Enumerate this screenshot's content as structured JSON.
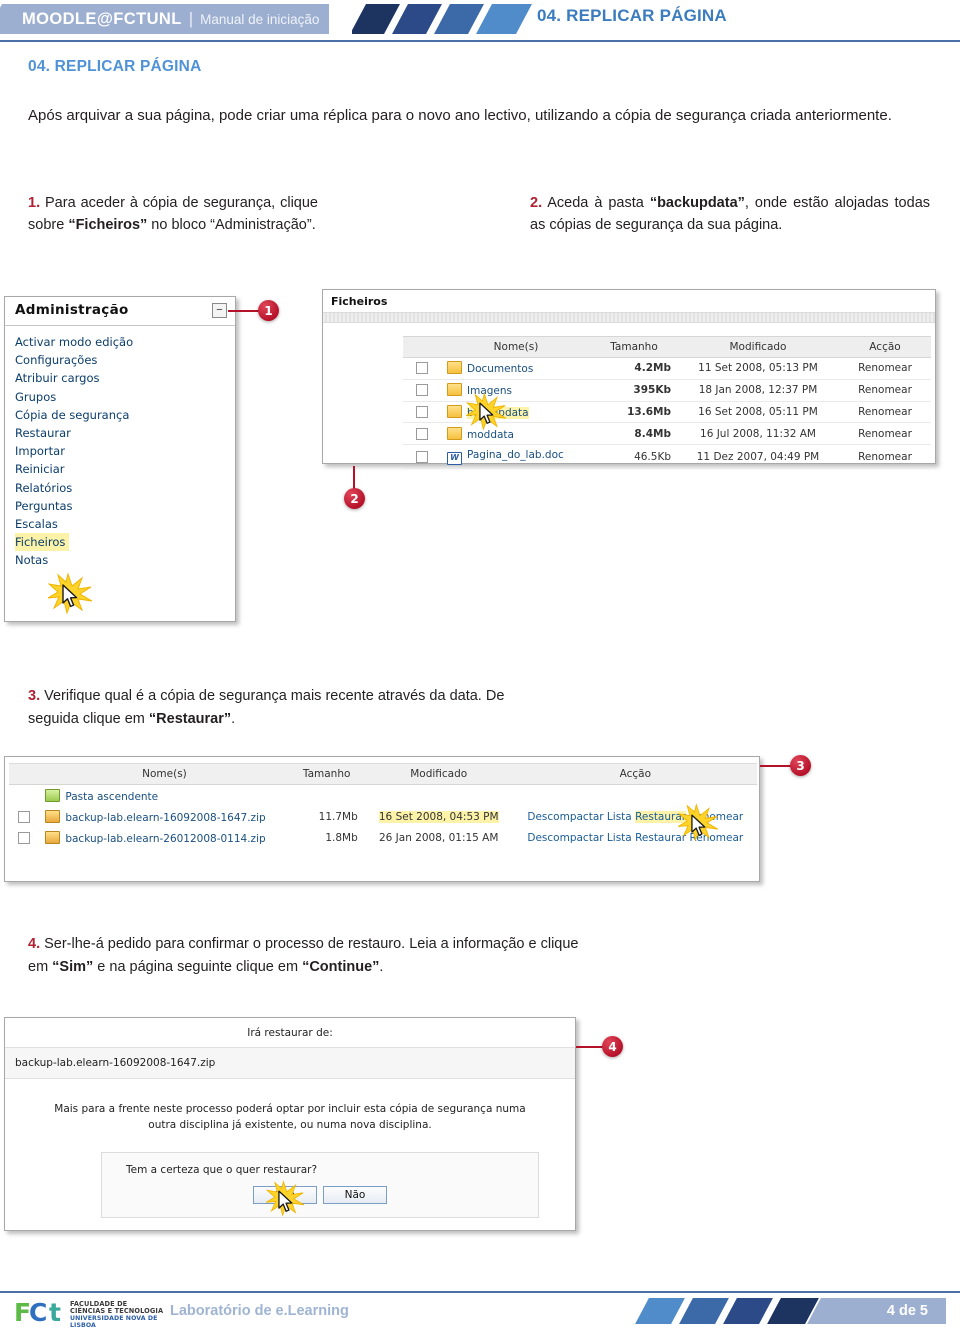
{
  "header": {
    "brand": "MOODLE@FCTUNL",
    "divider": "|",
    "subtitle": "Manual de iniciação",
    "title": "04. REPLICAR PÁGINA"
  },
  "page": {
    "section_title": "04. REPLICAR PÁGINA",
    "intro": "Após arquivar a sua página, pode criar uma réplica para o novo ano lectivo, utilizando a cópia de segurança criada anteriormente."
  },
  "steps": {
    "one": {
      "num": "1.",
      "t1": " Para aceder à cópia de segurança, clique sobre  ",
      "b1": "“Ficheiros”",
      "t2": " no bloco “Administração”."
    },
    "two": {
      "num": "2.",
      "t1": " Aceda à pasta ",
      "b1": "“backupdata”",
      "t2": ", onde estão alojadas todas as cópias de segurança da sua página."
    },
    "three": {
      "num": "3.",
      "t1": " Verifique qual é a cópia de segurança mais recente através da data. De seguida clique em ",
      "b1": "“Restaurar”",
      "t2": "."
    },
    "four": {
      "num": "4.",
      "t1": " Ser-lhe-á pedido para confirmar o processo de restauro. Leia a informação e clique em ",
      "b1": "“Sim”",
      "t2": " e na página seguinte clique em ",
      "b2": "“Continue”",
      "t3": "."
    }
  },
  "admin_block": {
    "title": "Administração",
    "collapse_glyph": "−",
    "items": [
      {
        "label": "Activar modo edição",
        "highlighted": false
      },
      {
        "label": "Configurações",
        "highlighted": false
      },
      {
        "label": "Atribuir cargos",
        "highlighted": false
      },
      {
        "label": "Grupos",
        "highlighted": false
      },
      {
        "label": "Cópia de segurança",
        "highlighted": false
      },
      {
        "label": "Restaurar",
        "highlighted": false
      },
      {
        "label": "Importar",
        "highlighted": false
      },
      {
        "label": "Reiniciar",
        "highlighted": false
      },
      {
        "label": "Relatórios",
        "highlighted": false
      },
      {
        "label": "Perguntas",
        "highlighted": false
      },
      {
        "label": "Escalas",
        "highlighted": false
      },
      {
        "label": "Ficheiros",
        "highlighted": true
      },
      {
        "label": "Notas",
        "highlighted": false
      }
    ]
  },
  "files_block": {
    "panel_title": "Ficheiros",
    "columns": [
      "Nome(s)",
      "Tamanho",
      "Modificado",
      "Acção"
    ],
    "rows": [
      {
        "icon": "folder-icon",
        "name": "Documentos",
        "size": "4.2Mb",
        "modified": "11 Set 2008, 05:13 PM",
        "action": "Renomear",
        "highlighted": false
      },
      {
        "icon": "folder-icon",
        "name": "Imagens",
        "size": "395Kb",
        "modified": "18 Jan 2008, 12:37 PM",
        "action": "Renomear",
        "highlighted": false
      },
      {
        "icon": "folder-icon",
        "name": "backupdata",
        "size": "13.6Mb",
        "modified": "16 Set 2008, 05:11 PM",
        "action": "Renomear",
        "highlighted": true
      },
      {
        "icon": "folder-icon",
        "name": "moddata",
        "size": "8.4Mb",
        "modified": "16 Jul 2008, 11:32 AM",
        "action": "Renomear",
        "highlighted": false
      },
      {
        "icon": "word-doc-icon",
        "name": "Pagina_do_lab.doc",
        "size": "46.5Kb",
        "modified": "11 Dez 2007, 04:49 PM",
        "action": "Renomear",
        "highlighted": false
      }
    ]
  },
  "backup_block": {
    "columns": [
      "Nome(s)",
      "Tamanho",
      "Modificado",
      "Acção"
    ],
    "parent_folder": "Pasta ascendente",
    "rows": [
      {
        "name": "backup-lab.elearn-16092008-1647.zip",
        "size": "11.7Mb",
        "modified": "16 Set 2008, 04:53 PM",
        "modified_highlighted": true,
        "actions": [
          "Descompactar",
          "Lista",
          "Restaurar",
          "Renomear"
        ],
        "action_highlighted": true
      },
      {
        "name": "backup-lab.elearn-26012008-0114.zip",
        "size": "1.8Mb",
        "modified": "26 Jan 2008, 01:15 AM",
        "modified_highlighted": false,
        "actions": [
          "Descompactar",
          "Lista",
          "Restaurar",
          "Renomear"
        ],
        "action_highlighted": false
      }
    ]
  },
  "dialog_block": {
    "heading": "Irá restaurar de:",
    "filename": "backup-lab.elearn-16092008-1647.zip",
    "info": "Mais para a frente neste processo poderá optar por incluir esta cópia de segurança numa outra disciplina já existente, ou numa nova disciplina.",
    "question": "Tem a certeza que o quer restaurar?",
    "yes_label": "Sim",
    "no_label": "Não"
  },
  "callouts": [
    {
      "num": "1"
    },
    {
      "num": "2"
    },
    {
      "num": "3"
    },
    {
      "num": "4"
    }
  ],
  "footer": {
    "logo_letters": [
      "F",
      "C",
      "t"
    ],
    "org_line1": "FACULDADE DE",
    "org_line2": "CIÊNCIAS E TECNOLOGIA",
    "org_line3": "UNIVERSIDADE NOVA DE LISBOA",
    "lab": "Laboratório de e.Learning",
    "page": "4 de 5"
  },
  "colors": {
    "accent_blue": "#4f93d6",
    "header_bar": "#9dafd0",
    "rule": "#4d6fa8",
    "step_num_red": "#b01f32",
    "badge_red": "#b5122a",
    "highlight_yellow": "#fdf3a8",
    "moodle_link": "#0b3d6b"
  }
}
